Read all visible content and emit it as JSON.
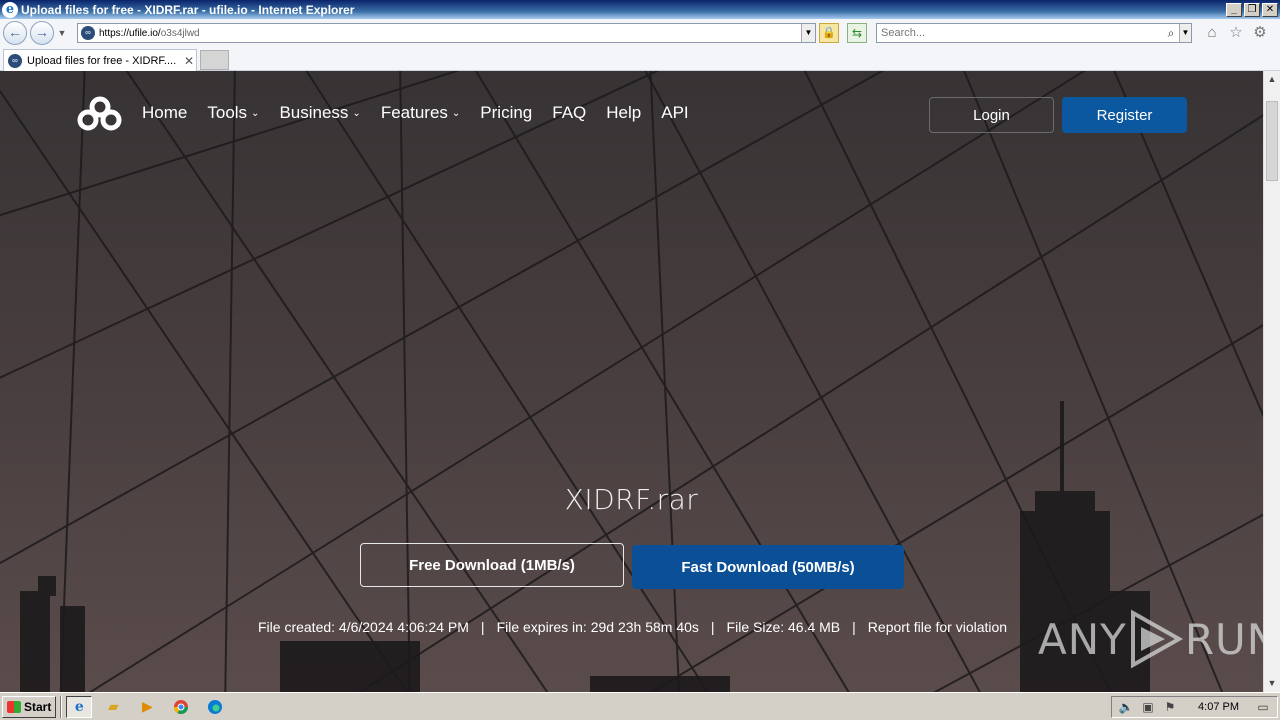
{
  "window": {
    "title": "Upload files for free - XIDRF.rar - ufile.io - Internet Explorer",
    "controls": {
      "minimize": "_",
      "restore": "❐",
      "close": "✕"
    }
  },
  "navbar": {
    "url_host": "https://ufile.io/",
    "url_path": "o3s4jlwd",
    "search_placeholder": "Search..."
  },
  "tab": {
    "title": "Upload files for free - XIDRF....",
    "close": "✕"
  },
  "site": {
    "nav": [
      {
        "label": "Home",
        "dropdown": false
      },
      {
        "label": "Tools",
        "dropdown": true
      },
      {
        "label": "Business",
        "dropdown": true
      },
      {
        "label": "Features",
        "dropdown": true
      },
      {
        "label": "Pricing",
        "dropdown": false
      },
      {
        "label": "FAQ",
        "dropdown": false
      },
      {
        "label": "Help",
        "dropdown": false
      },
      {
        "label": "API",
        "dropdown": false
      }
    ],
    "login_label": "Login",
    "register_label": "Register",
    "filename": "XIDRF.rar",
    "free_download_label": "Free Download (1MB/s)",
    "fast_download_label": "Fast Download (50MB/s)",
    "meta": {
      "created": "File created: 4/6/2024 4:06:24 PM",
      "expires": "File expires in: 29d 23h 58m 40s",
      "size": "File Size: 46.4 MB",
      "report": "Report file for violation",
      "separator": "|"
    },
    "colors": {
      "primary_blue": "#0b57a0",
      "background": "#3d3638"
    }
  },
  "watermark": {
    "text_left": "ANY",
    "text_right": "RUN"
  },
  "taskbar": {
    "start_label": "Start",
    "clock": "4:07 PM",
    "icons": [
      "ie-icon",
      "folder-icon",
      "media-player-icon",
      "chrome-icon",
      "edge-icon"
    ]
  }
}
